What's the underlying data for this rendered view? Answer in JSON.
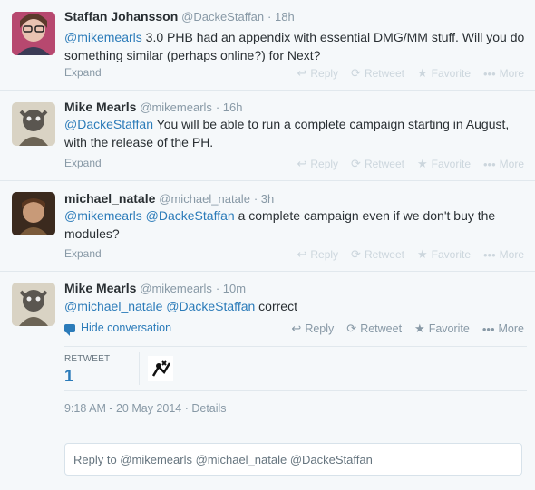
{
  "tweets": [
    {
      "fullname": "Staffan Johansson",
      "username": "@DackeStaffan",
      "time": "· 18h",
      "mentions": "@mikemearls",
      "text": " 3.0 PHB had an appendix with essential DMG/MM stuff. Will you do something similar (perhaps online?) for Next?",
      "expand": "Expand"
    },
    {
      "fullname": "Mike Mearls",
      "username": "@mikemearls",
      "time": "· 16h",
      "mentions": "@DackeStaffan",
      "text": " You will be able to run a complete campaign starting in August, with the release of the PH.",
      "expand": "Expand"
    },
    {
      "fullname": "michael_natale",
      "username": "@michael_natale",
      "time": "· 3h",
      "mentions": "@mikemearls @DackeStaffan",
      "text": " a complete campaign even if we don't buy the modules?",
      "expand": "Expand"
    },
    {
      "fullname": "Mike Mearls",
      "username": "@mikemearls",
      "time": "· 10m",
      "mentions": "@michael_natale @DackeStaffan",
      "text": " correct"
    }
  ],
  "actions": {
    "reply": "Reply",
    "retweet": "Retweet",
    "favorite": "Favorite",
    "more": "More"
  },
  "icons": {
    "reply": "reply-arrow-icon",
    "retweet": "retweet-icon",
    "favorite": "star-icon",
    "more": "ellipsis-icon"
  },
  "hide_conversation": "Hide conversation",
  "stats": {
    "retweet_label": "RETWEET",
    "retweet_count": "1"
  },
  "timestamp": "9:18 AM - 20 May 2014 · Details",
  "reply_box": {
    "text": "Reply to @mikemearls @michael_natale @DackeStaffan"
  },
  "colors": {
    "link": "#2b7bb9",
    "muted": "#8899a6",
    "faint": "#ccd6dd",
    "border": "#e1e8ed",
    "background_alt": "#f5f8fa"
  }
}
